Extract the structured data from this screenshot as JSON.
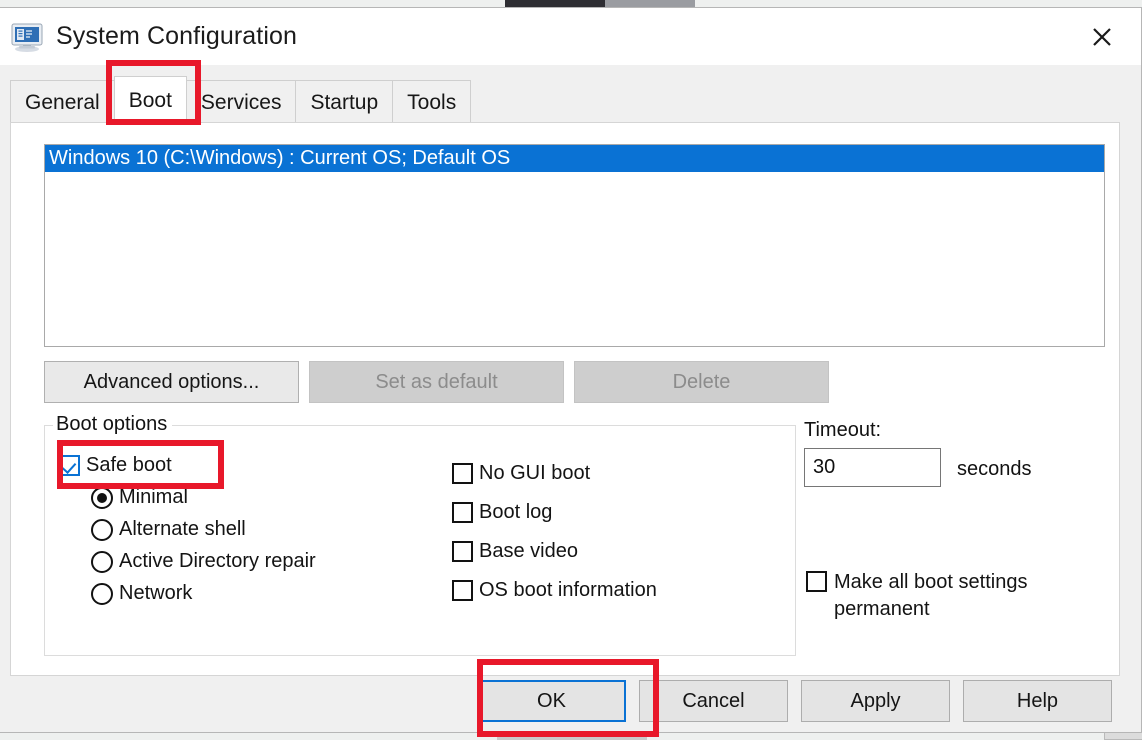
{
  "window": {
    "title": "System Configuration",
    "icon": "system-configuration-icon",
    "close_label": "✕"
  },
  "tabs": [
    {
      "label": "General",
      "active": false
    },
    {
      "label": "Boot",
      "active": true
    },
    {
      "label": "Services",
      "active": false
    },
    {
      "label": "Startup",
      "active": false
    },
    {
      "label": "Tools",
      "active": false
    }
  ],
  "os_list": {
    "items": [
      {
        "label": "Windows 10 (C:\\Windows) : Current OS; Default OS",
        "selected": true
      }
    ]
  },
  "action_buttons": [
    {
      "label": "Advanced options...",
      "disabled": false
    },
    {
      "label": "Set as default",
      "disabled": true
    },
    {
      "label": "Delete",
      "disabled": true
    }
  ],
  "boot_options": {
    "legend": "Boot options",
    "safe_boot": {
      "label": "Safe boot",
      "checked": true
    },
    "safe_boot_modes": [
      {
        "label": "Minimal",
        "selected": true
      },
      {
        "label": "Alternate shell",
        "selected": false
      },
      {
        "label": "Active Directory repair",
        "selected": false
      },
      {
        "label": "Network",
        "selected": false
      }
    ],
    "flags": [
      {
        "label": "No GUI boot",
        "checked": false
      },
      {
        "label": "Boot log",
        "checked": false
      },
      {
        "label": "Base video",
        "checked": false
      },
      {
        "label": "OS boot information",
        "checked": false
      }
    ]
  },
  "timeout": {
    "label": "Timeout:",
    "value": "30",
    "units": "seconds",
    "make_permanent": {
      "label": "Make all boot settings permanent",
      "checked": false
    }
  },
  "footer_buttons": [
    {
      "label": "OK",
      "default": true
    },
    {
      "label": "Cancel",
      "default": false
    },
    {
      "label": "Apply",
      "default": false
    },
    {
      "label": "Help",
      "default": false
    }
  ],
  "annotations": {
    "color": "#e8182a",
    "targets": [
      "Boot tab",
      "Safe boot checkbox",
      "OK button"
    ]
  },
  "colors": {
    "accent": "#0a72d4",
    "selection": "#0a72d4",
    "annotation": "#e8182a",
    "dialog_bg": "#f0f0f0",
    "panel_bg": "#ffffff"
  }
}
